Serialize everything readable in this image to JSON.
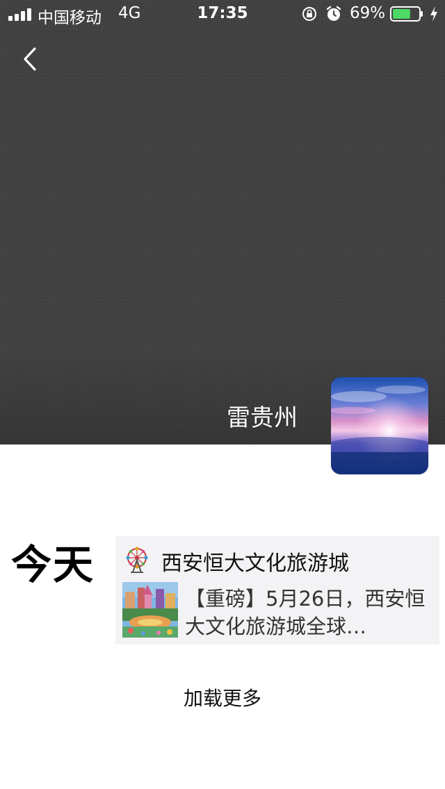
{
  "status_bar": {
    "carrier": "中国移动",
    "network": "4G",
    "time": "17:35",
    "battery_percent": "69%",
    "battery_level": 0.69,
    "battery_color": "#4cd964"
  },
  "profile": {
    "username": "雷贵州",
    "cover_color": "#3f3f3f"
  },
  "timeline": {
    "day_label": "今天",
    "post": {
      "account_name": "西安恒大文化旅游城",
      "article_title": "【重磅】5月26日，西安恒大文化旅游城全球…",
      "card_background": "#f3f3f5"
    }
  },
  "load_more_label": "加载更多",
  "icons": {
    "back": "chevron-left-icon",
    "rotation_lock": "rotation-lock-icon",
    "alarm": "alarm-icon",
    "battery": "battery-icon",
    "charging": "lightning-bolt-icon",
    "account": "ferris-wheel-icon"
  }
}
